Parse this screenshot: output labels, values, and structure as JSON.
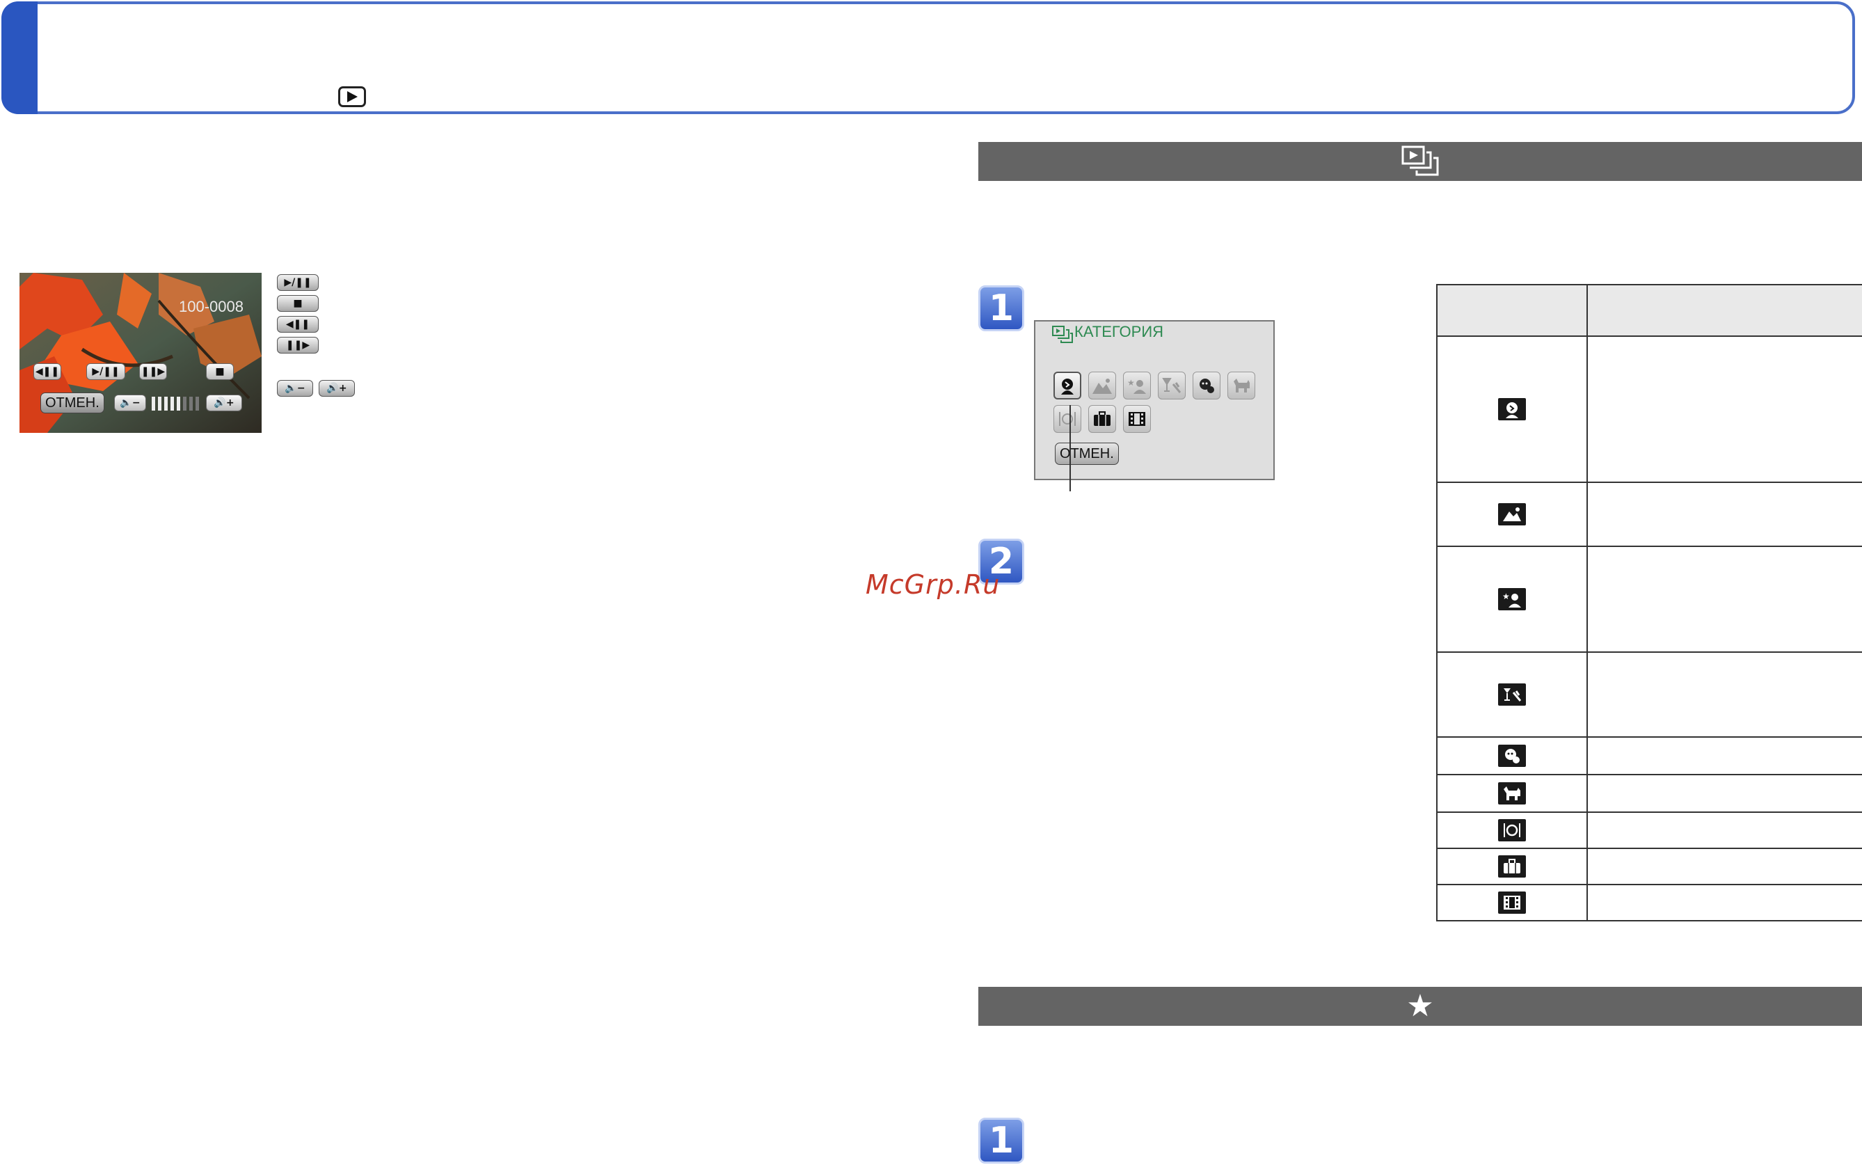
{
  "header": {
    "play_icon": "playback-mode-icon"
  },
  "left": {
    "photo": {
      "file_number": "100-0008",
      "cancel_label": "ОТМЕН."
    }
  },
  "right": {
    "category_section_icon": "category-play-icon",
    "category_screen": {
      "title": "КАТЕГОРИЯ",
      "cancel_label": "ОТМЕН."
    },
    "steps": [
      "1",
      "2"
    ],
    "favorites_section_icon": "★",
    "favorites_step": "1"
  },
  "watermark": "McGrp.Ru",
  "table_icons": [
    "portrait-icon",
    "scenery-icon",
    "night-portrait-icon",
    "party-icon",
    "baby-icon",
    "pet-icon",
    "food-icon",
    "travel-icon",
    "movie-icon"
  ]
}
